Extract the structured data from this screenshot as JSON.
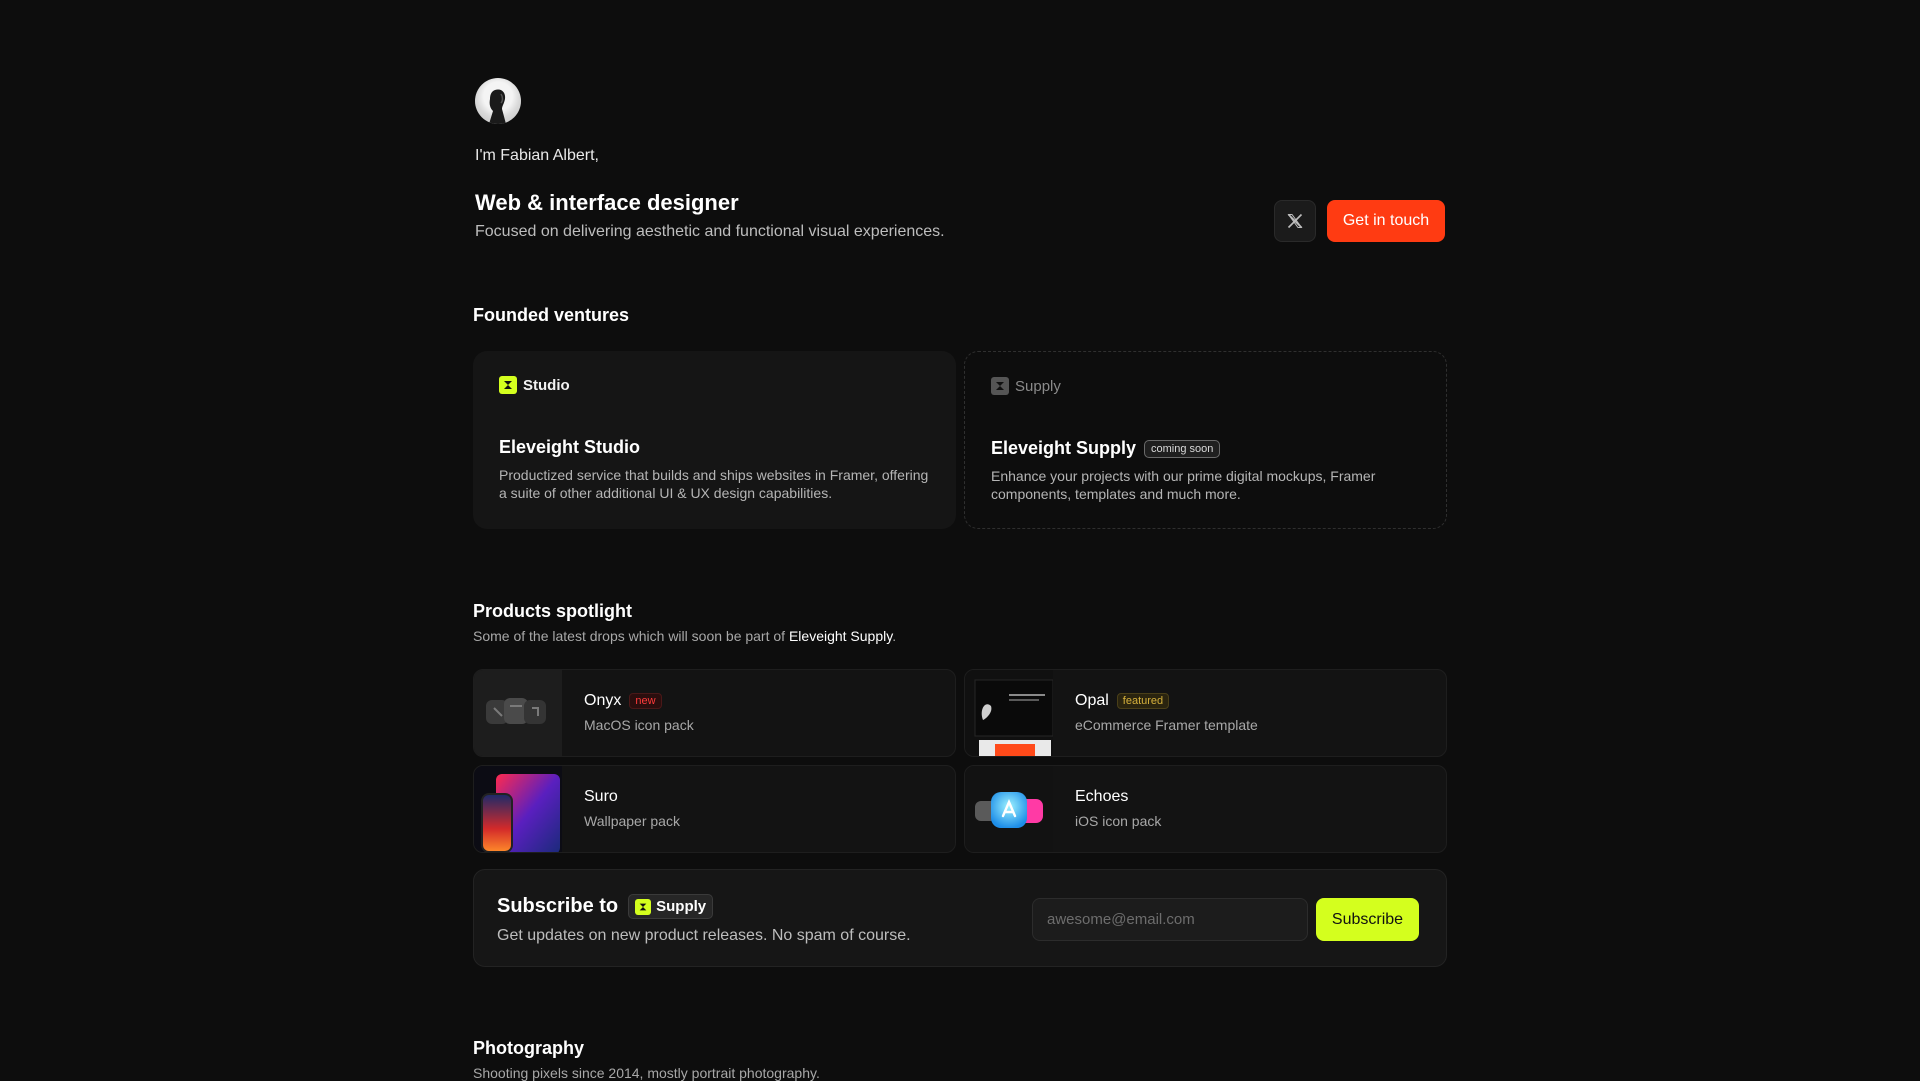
{
  "profile": {
    "intro": "I'm Fabian Albert,",
    "role": "Web & interface designer",
    "tagline": "Focused on delivering aesthetic and functional visual experiences.",
    "cta_label": "Get in touch"
  },
  "ventures": {
    "title": "Founded ventures",
    "items": [
      {
        "logo_text": "Studio",
        "title": "Eleveight Studio",
        "description": "Productized service that builds and ships websites in Framer, offering a suite of other additional UI & UX design capabilities."
      },
      {
        "logo_text": "Supply",
        "title": "Eleveight Supply",
        "badge": "coming soon",
        "description": "Enhance your projects with our prime digital mockups, Framer components, templates and much more."
      }
    ]
  },
  "products": {
    "title": "Products spotlight",
    "subtitle_prefix": "Some of the latest drops which will soon be part of",
    "subtitle_link": "Eleveight Supply",
    "subtitle_suffix": ".",
    "items": [
      {
        "name": "Onyx",
        "badge": "new",
        "subtitle": "MacOS icon pack"
      },
      {
        "name": "Opal",
        "badge": "featured",
        "subtitle": "eCommerce Framer template"
      },
      {
        "name": "Suro",
        "subtitle": "Wallpaper pack"
      },
      {
        "name": "Echoes",
        "subtitle": "iOS icon pack"
      }
    ]
  },
  "subscribe": {
    "title_prefix": "Subscribe to",
    "chip": "Supply",
    "description": "Get updates on new product releases. No spam of course.",
    "email_placeholder": "awesome@email.com",
    "button_label": "Subscribe"
  },
  "photography": {
    "title": "Photography",
    "subtitle": "Shooting pixels since 2014, mostly portrait photography."
  },
  "colors": {
    "accent_orange": "#ff3b12",
    "accent_lime": "#d4ff1e",
    "background": "#0d0d0d"
  }
}
